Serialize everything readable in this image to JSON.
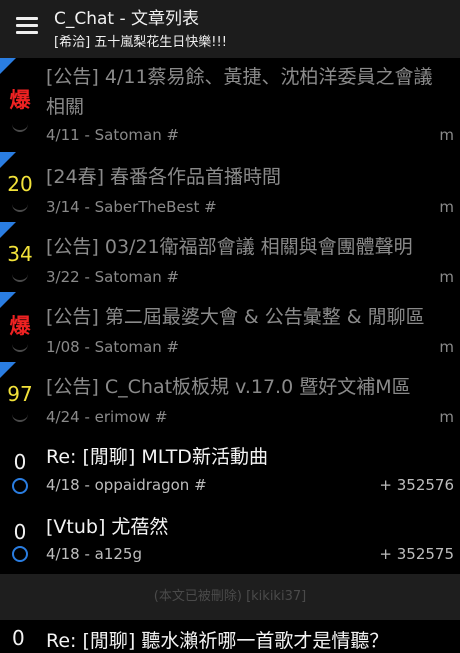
{
  "header": {
    "title": "C_Chat - 文章列表",
    "subtitle": "[希洽] 五十嵐梨花生日快樂!!!"
  },
  "posts": [
    {
      "score": "爆",
      "title": "[公告] 4/11蔡易餘、黃捷、沈柏洋委員之會議相關",
      "meta": "4/11 - Satoman #",
      "mark": "m"
    },
    {
      "score": "20",
      "title": "[24春] 春番各作品首播時間",
      "meta": "3/14 - SaberTheBest #",
      "mark": "m"
    },
    {
      "score": "34",
      "title": "[公告] 03/21衛福部會議 相關與會團體聲明",
      "meta": "3/22 - Satoman #",
      "mark": "m"
    },
    {
      "score": "爆",
      "title": "[公告] 第二屆最婆大會 & 公告彙整 & 閒聊區",
      "meta": "1/08 - Satoman #",
      "mark": "m"
    },
    {
      "score": "97",
      "title": "[公告] C_Chat板板規 v.17.0 暨好文補M區",
      "meta": "4/24 - erimow #",
      "mark": "m"
    },
    {
      "score": "0",
      "title": "Re: [閒聊] MLTD新活動曲",
      "meta": "4/18 - oppaidragon #",
      "mark": "+ 352576"
    },
    {
      "score": "0",
      "title": "[Vtub] 尤蓓然",
      "meta": "4/18 - a125g",
      "mark": "+ 352575"
    }
  ],
  "deleted_notice": "(本文已被刪除) [kikiki37]",
  "partial_row": {
    "score": "0",
    "title": "Re: [閒聊] 聽水瀨祈哪一首歌才是情聽？"
  }
}
